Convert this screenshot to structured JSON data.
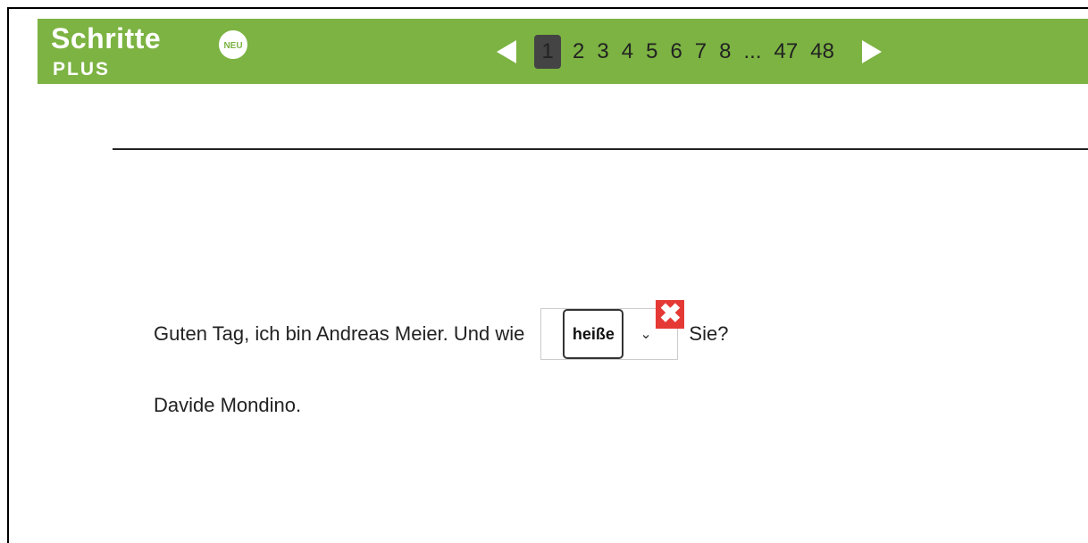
{
  "header": {
    "logo_main": "Schritte",
    "logo_badge": "NEU",
    "logo_sub": "PLUS",
    "pages": [
      "1",
      "2",
      "3",
      "4",
      "5",
      "6",
      "7",
      "8",
      "...",
      "47",
      "48"
    ],
    "current_page": "1"
  },
  "exercise": {
    "sentence_before": "Guten Tag, ich bin Andreas Meier. Und wie",
    "selected_option": "heiße",
    "sentence_after": "Sie?",
    "answer_line": "Davide Mondino.",
    "feedback_icon": "wrong-x-icon"
  },
  "colors": {
    "header_bg": "#7cb342",
    "wrong_bg": "#e53935"
  }
}
